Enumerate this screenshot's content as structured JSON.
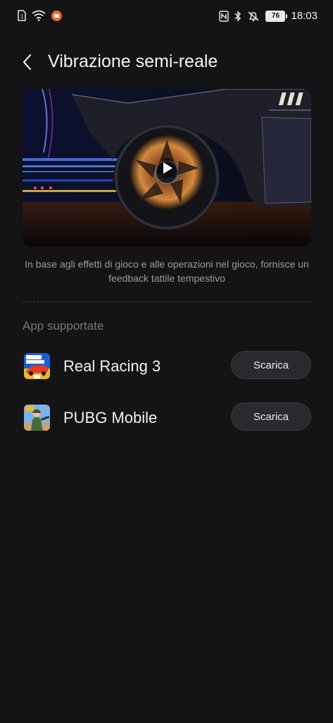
{
  "status_bar": {
    "sim_label": "1",
    "battery": "76",
    "time": "18:03"
  },
  "header": {
    "back_icon": "chevron-left-icon",
    "title": "Vibrazione semi-reale"
  },
  "hero": {
    "play_icon": "play-icon"
  },
  "description": "In base agli effetti di gioco e alle operazioni nel gioco, fornisce un feedback tattile tempestivo",
  "section_title": "App supportate",
  "apps": [
    {
      "name": "Real Racing 3",
      "button": "Scarica",
      "icon": "real-racing-3-app-icon"
    },
    {
      "name": "PUBG Mobile",
      "button": "Scarica",
      "icon": "pubg-mobile-app-icon"
    }
  ],
  "colors": {
    "background": "#141416",
    "button_bg": "#2a2a2e",
    "text_secondary": "#9a9a9f",
    "status_orange": "#f06a2d"
  }
}
